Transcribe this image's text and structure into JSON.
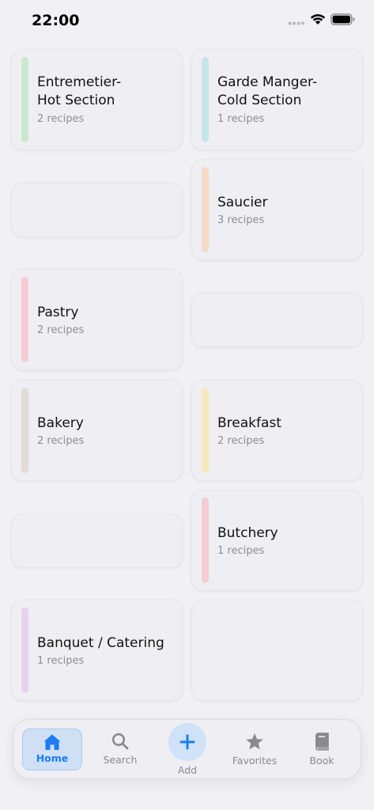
{
  "status_bar": {
    "time": "22:00"
  },
  "categories": [
    {
      "title_line1": "Entremetier-",
      "title_line2": "Hot Section",
      "subtitle": "2 recipes",
      "color": "#c9e8cc"
    },
    {
      "title_line1": "Garde Manger-",
      "title_line2": "Cold Section",
      "subtitle": "1 recipes",
      "color": "#c4e6ea"
    },
    {
      "title_line1": "Saucier",
      "subtitle": "3 recipes",
      "color": "#f4dcc6"
    },
    {
      "title_line1": "Pastry",
      "subtitle": "2 recipes",
      "color": "#f5ccd5"
    },
    {
      "title_line1": "Bakery",
      "subtitle": "2 recipes",
      "color": "#e2dbd6"
    },
    {
      "title_line1": "Breakfast",
      "subtitle": "2 recipes",
      "color": "#f3ebbe"
    },
    {
      "title_line1": "Butchery",
      "subtitle": "1 recipes",
      "color": "#f2cdd1"
    },
    {
      "title_line1": "Banquet / Catering",
      "subtitle": "1 recipes",
      "color": "#e8d0ef"
    }
  ],
  "tab_bar": {
    "home": "Home",
    "search": "Search",
    "add": "Add",
    "favorites": "Favorites",
    "book": "Book",
    "active_color": "#1d7cf2",
    "inactive_color": "#8a8a8e"
  }
}
